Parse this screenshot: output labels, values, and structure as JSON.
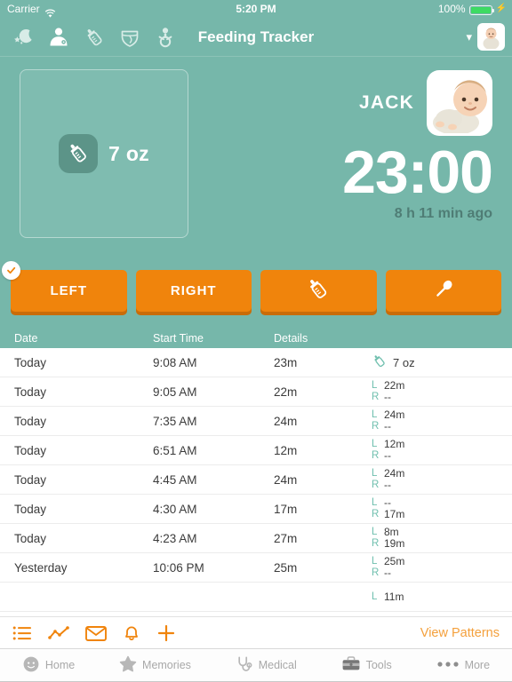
{
  "status_bar": {
    "carrier": "Carrier",
    "wifi_icon": "wifi-icon",
    "time": "5:20 PM",
    "battery_percent": "100%",
    "battery_icon": "battery-full-icon",
    "charging_icon": "lightning-bolt-icon"
  },
  "nav": {
    "title": "Feeding Tracker",
    "icons": [
      {
        "name": "sleep-moon-stars-icon",
        "label": "Sleep"
      },
      {
        "name": "nursing-icon",
        "label": "Nursing"
      },
      {
        "name": "bottle-icon",
        "label": "Bottle"
      },
      {
        "name": "diaper-icon",
        "label": "Diaper"
      },
      {
        "name": "baby-growth-icon",
        "label": "Growth"
      }
    ],
    "chevron": "▾",
    "avatar_name": "baby-avatar"
  },
  "hero": {
    "amount_card": {
      "icon": "bottle-icon",
      "value": "7 oz"
    },
    "baby_name": "JACK",
    "timer": "23:00",
    "since": "8 h 11 min ago"
  },
  "actions": {
    "buttons": [
      {
        "label": "LEFT",
        "icon": null,
        "checked": true
      },
      {
        "label": "RIGHT",
        "icon": null,
        "checked": false
      },
      {
        "label": "",
        "icon": "bottle-icon",
        "checked": false
      },
      {
        "label": "",
        "icon": "spoon-icon",
        "checked": false
      }
    ],
    "check_glyph": "✓"
  },
  "table": {
    "columns": [
      "Date",
      "Start Time",
      "Details",
      ""
    ],
    "rows": [
      {
        "date": "Today",
        "start": "9:08 AM",
        "duration": "23m",
        "type": "bottle",
        "amount": "7 oz"
      },
      {
        "date": "Today",
        "start": "9:05 AM",
        "duration": "22m",
        "type": "nursing",
        "left": "22m",
        "right": "--"
      },
      {
        "date": "Today",
        "start": "7:35 AM",
        "duration": "24m",
        "type": "nursing",
        "left": "24m",
        "right": "--"
      },
      {
        "date": "Today",
        "start": "6:51 AM",
        "duration": "12m",
        "type": "nursing",
        "left": "12m",
        "right": "--"
      },
      {
        "date": "Today",
        "start": "4:45 AM",
        "duration": "24m",
        "type": "nursing",
        "left": "24m",
        "right": "--"
      },
      {
        "date": "Today",
        "start": "4:30 AM",
        "duration": "17m",
        "type": "nursing",
        "left": "--",
        "right": "17m"
      },
      {
        "date": "Today",
        "start": "4:23 AM",
        "duration": "27m",
        "type": "nursing",
        "left": "8m",
        "right": "19m"
      },
      {
        "date": "Yesterday",
        "start": "10:06 PM",
        "duration": "25m",
        "type": "nursing",
        "left": "25m",
        "right": "--"
      },
      {
        "date": "",
        "start": "",
        "duration": "",
        "type": "nursing",
        "left": "11m",
        "right": ""
      }
    ],
    "labels": {
      "left": "L",
      "right": "R"
    }
  },
  "toolbar": {
    "icons": [
      {
        "name": "list-icon"
      },
      {
        "name": "chart-line-icon"
      },
      {
        "name": "envelope-icon"
      },
      {
        "name": "bell-icon"
      },
      {
        "name": "plus-icon"
      }
    ],
    "view_patterns": "View Patterns"
  },
  "tabbar": {
    "tabs": [
      {
        "label": "Home",
        "icon": "home-face-icon"
      },
      {
        "label": "Memories",
        "icon": "star-icon"
      },
      {
        "label": "Medical",
        "icon": "stethoscope-icon"
      },
      {
        "label": "Tools",
        "icon": "toolbox-icon"
      },
      {
        "label": "More",
        "icon": "ellipsis-icon"
      }
    ]
  },
  "colors": {
    "background_teal": "#76b7aa",
    "card_teal": "#7fbdb0",
    "accent_orange": "#f0840c",
    "orange_shadow": "#c96c08",
    "link_orange": "#f4a03c",
    "lr_green": "#6fbfae",
    "muted_text": "#4f7d75"
  }
}
